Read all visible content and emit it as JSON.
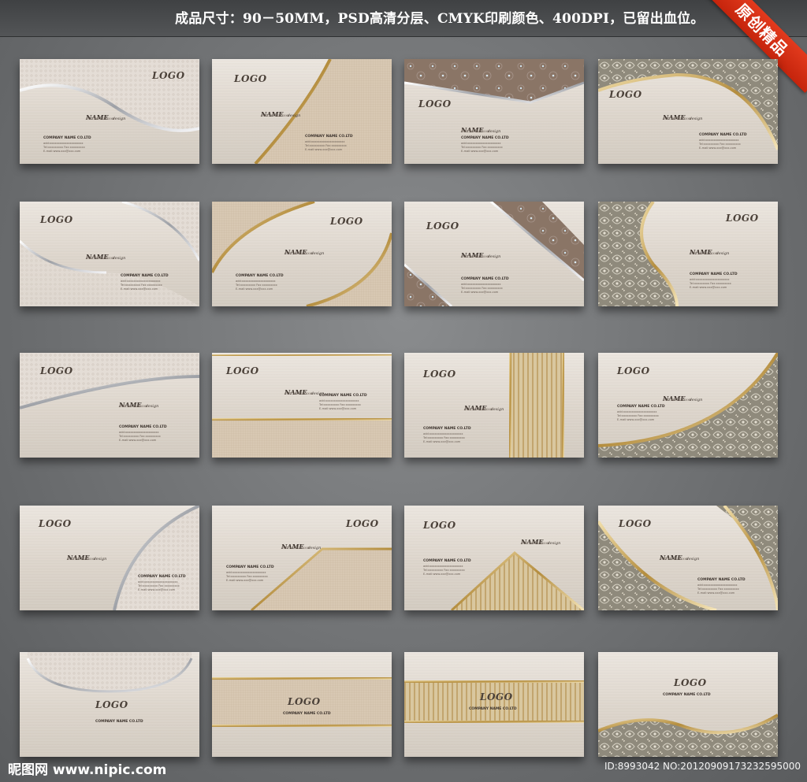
{
  "header": {
    "title": "成品尺寸：90－50MM，PSD高清分层、CMYK印刷颜色、400DPI，已留出血位。",
    "badge": "原创精品"
  },
  "card_text": {
    "logo": "LOGO",
    "name": "NAME",
    "design": "design",
    "mob": "mob:xxxxxxxxxxx",
    "company": "COMPANY NAME CO.LTD",
    "add": "add:xxxxxxxxxxxxxxxxxxxx",
    "tel": "Tel:xxxxxxxxx  Fax:xxxxxxxxx",
    "email": "E-mail:www.xxx@xxx.com"
  },
  "footer": {
    "site": "昵图网 www.nipic.com",
    "id": "ID:8993042 NO:20120909173232595000"
  },
  "colors": {
    "silver": "#b9bcc1",
    "gold": "#c9a75c",
    "brown_pattern": "#8a7566",
    "damask": "#8f8a7c",
    "beige_band": "#d5c2a8"
  }
}
